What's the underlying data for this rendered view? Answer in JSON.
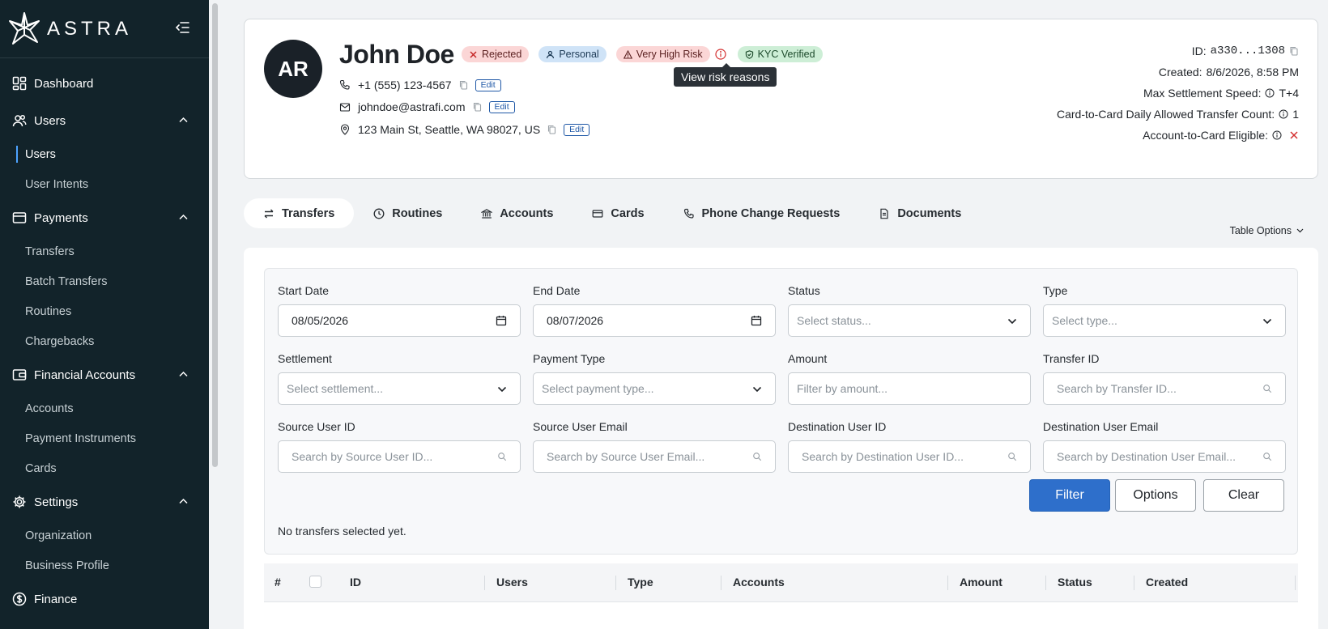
{
  "app": {
    "name": "ASTRA"
  },
  "sidebar": {
    "sections": [
      {
        "label": "Dashboard",
        "icon": "dashboard-icon",
        "items": []
      },
      {
        "label": "Users",
        "icon": "users-icon",
        "items": [
          {
            "label": "Users",
            "active": true
          },
          {
            "label": "User Intents"
          }
        ]
      },
      {
        "label": "Payments",
        "icon": "payments-icon",
        "items": [
          {
            "label": "Transfers"
          },
          {
            "label": "Batch Transfers"
          },
          {
            "label": "Routines"
          },
          {
            "label": "Chargebacks"
          }
        ]
      },
      {
        "label": "Financial Accounts",
        "icon": "wallet-icon",
        "items": [
          {
            "label": "Accounts"
          },
          {
            "label": "Payment Instruments"
          },
          {
            "label": "Cards"
          }
        ]
      },
      {
        "label": "Settings",
        "icon": "gear-icon",
        "items": [
          {
            "label": "Organization"
          },
          {
            "label": "Business Profile"
          }
        ]
      },
      {
        "label": "Finance",
        "icon": "dollar-circle-icon",
        "items": []
      }
    ]
  },
  "profile": {
    "initials": "AR",
    "name": "John Doe",
    "badges": {
      "rejected": "Rejected",
      "personal": "Personal",
      "risk": "Very High Risk",
      "kyc": "KYC Verified"
    },
    "tooltip": "View risk reasons",
    "phone": "+1 (555) 123-4567",
    "email": "johndoe@astrafi.com",
    "address": "123 Main St, Seattle, WA 98027, US",
    "edit_label": "Edit",
    "meta": {
      "id_label": "ID:",
      "id_value": "a330...1308",
      "created_label": "Created:",
      "created_value": "8/6/2026, 8:58 PM",
      "speed_label": "Max Settlement Speed:",
      "speed_value": "T+4",
      "c2c_label": "Card-to-Card Daily Allowed Transfer Count:",
      "c2c_value": "1",
      "a2c_label": "Account-to-Card Eligible:"
    }
  },
  "tabs": [
    {
      "label": "Transfers",
      "icon": "transfer-arrows-icon",
      "active": true
    },
    {
      "label": "Routines",
      "icon": "clock-icon"
    },
    {
      "label": "Accounts",
      "icon": "bank-icon"
    },
    {
      "label": "Cards",
      "icon": "card-icon"
    },
    {
      "label": "Phone Change Requests",
      "icon": "phone-icon"
    },
    {
      "label": "Documents",
      "icon": "document-icon"
    }
  ],
  "table_options_label": "Table Options",
  "filters": {
    "start_date": {
      "label": "Start Date",
      "value": "08/05/2026"
    },
    "end_date": {
      "label": "End Date",
      "value": "08/07/2026"
    },
    "status": {
      "label": "Status",
      "placeholder": "Select status..."
    },
    "type": {
      "label": "Type",
      "placeholder": "Select type..."
    },
    "settlement": {
      "label": "Settlement",
      "placeholder": "Select settlement..."
    },
    "payment_type": {
      "label": "Payment Type",
      "placeholder": "Select payment type..."
    },
    "amount": {
      "label": "Amount",
      "placeholder": "Filter by amount..."
    },
    "transfer_id": {
      "label": "Transfer ID",
      "placeholder": "Search by Transfer ID..."
    },
    "source_user_id": {
      "label": "Source User ID",
      "placeholder": "Search by Source User ID..."
    },
    "source_user_email": {
      "label": "Source User Email",
      "placeholder": "Search by Source User Email..."
    },
    "dest_user_id": {
      "label": "Destination User ID",
      "placeholder": "Search by Destination User ID..."
    },
    "dest_user_email": {
      "label": "Destination User Email",
      "placeholder": "Search by Destination User Email..."
    },
    "buttons": {
      "filter": "Filter",
      "options": "Options",
      "clear": "Clear"
    },
    "status_message": "No transfers selected yet."
  },
  "table": {
    "columns": [
      "#",
      "ID",
      "Users",
      "Type",
      "Accounts",
      "Amount",
      "Status",
      "Created"
    ]
  },
  "colors": {
    "sidebar_bg": "#12232a",
    "primary": "#2e6fcb",
    "risk_bg": "#fbd6d6",
    "kyc_bg": "#cdeed6",
    "personal_bg": "#cfe3f7",
    "error": "#d32f2f"
  }
}
